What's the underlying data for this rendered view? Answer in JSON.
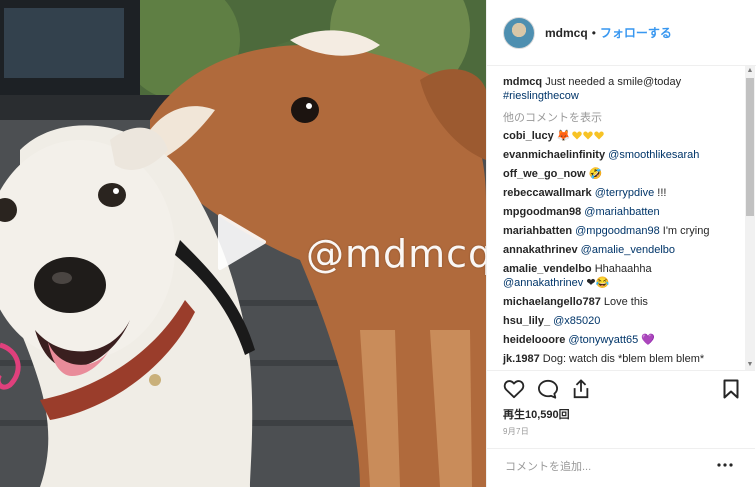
{
  "media": {
    "watermark": "@mdmcq"
  },
  "header": {
    "username": "mdmcq",
    "separator": "•",
    "follow_label": "フォローする"
  },
  "caption": {
    "username": "mdmcq",
    "text": "Just needed a smile@today",
    "hashtag": "#rieslingthecow"
  },
  "more_comments_label": "他のコメントを表示",
  "comments": [
    {
      "user": "cobi_lucy",
      "text": "🦊",
      "hearts": 3
    },
    {
      "user": "evanmichaelinfinity",
      "mention": "@smoothlikesarah",
      "text": ""
    },
    {
      "user": "off_we_go_now",
      "text": "🤣"
    },
    {
      "user": "rebeccawallmark",
      "mention": "@terrypdive",
      "text": " !!!"
    },
    {
      "user": "mpgoodman98",
      "mention": "@mariahbatten",
      "text": ""
    },
    {
      "user": "mariahbatten",
      "mention": "@mpgoodman98",
      "text": " I'm crying"
    },
    {
      "user": "annakathrinev",
      "mention": "@amalie_vendelbo",
      "text": ""
    },
    {
      "user": "amalie_vendelbo",
      "text": "Hhahaahha",
      "mention2": "@annakathrinev",
      "text2": " ❤😂"
    },
    {
      "user": "michaelangello787",
      "text": "Love this"
    },
    {
      "user": "hsu_lily_",
      "mention": "@x85020",
      "text": ""
    },
    {
      "user": "heidelooore",
      "mention": "@tonywyatt65",
      "text": " 💜"
    },
    {
      "user": "jk.1987",
      "text": "Dog: watch dis *blem blem blem*"
    }
  ],
  "stats": {
    "views": "再生10,590回",
    "date": "9月7日"
  },
  "add_comment": {
    "placeholder": "コメントを追加..."
  },
  "colors": {
    "accent": "#3897f0",
    "link": "#003569",
    "heart_yellow": "#f7c325",
    "heart_purple": "#9b59d0"
  },
  "icons": [
    "heart-icon",
    "comment-icon",
    "share-icon",
    "bookmark-icon",
    "more-icon",
    "play-icon"
  ]
}
